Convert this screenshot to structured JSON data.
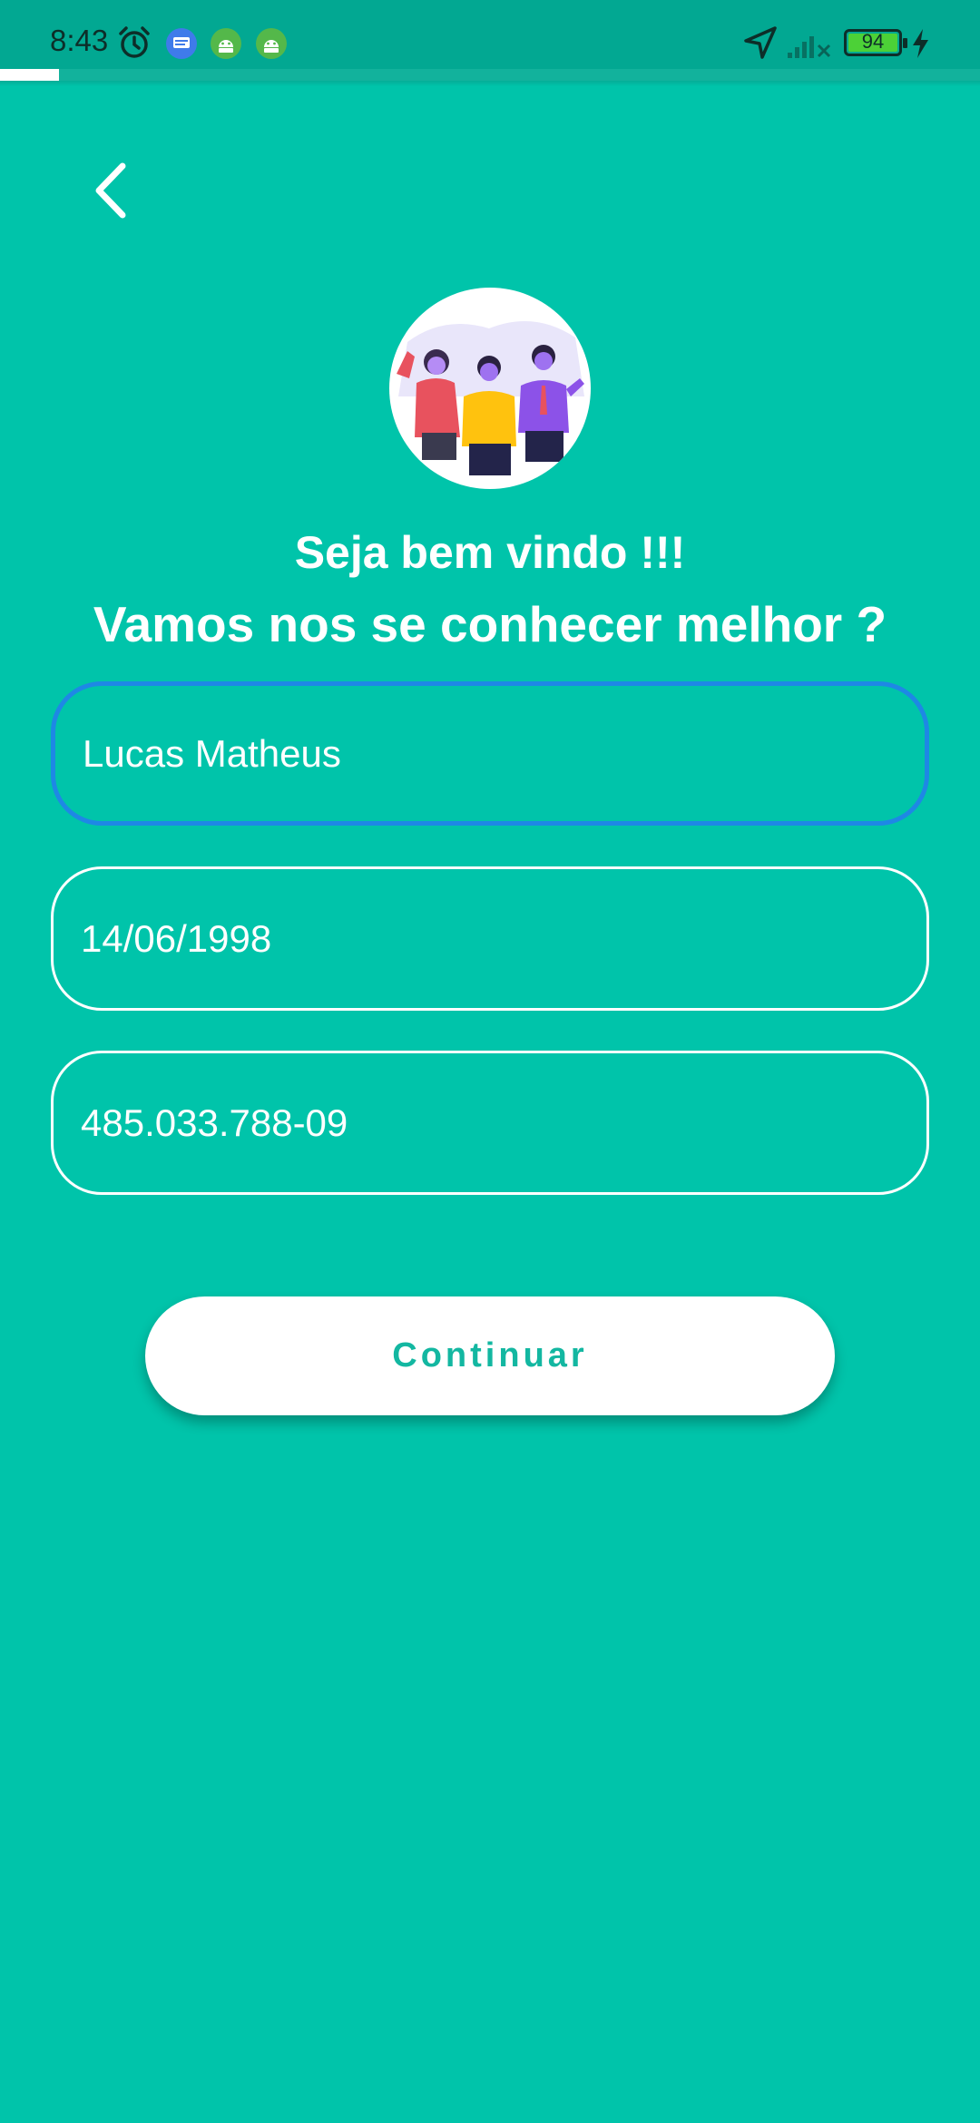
{
  "status_bar": {
    "time": "8:43",
    "battery_level": "94",
    "icons": [
      "alarm-icon",
      "messages-icon",
      "android-icon",
      "android-icon",
      "location-icon",
      "signal-icon",
      "battery-icon",
      "charging-icon"
    ]
  },
  "progress": {
    "value_percent": 6
  },
  "header": {
    "back_icon": "chevron-left-icon"
  },
  "welcome": {
    "title": "Seja bem vindo !!!",
    "subtitle": "Vamos nos se conhecer melhor ?"
  },
  "form": {
    "name_value": "Lucas Matheus",
    "birthdate_value": "14/06/1998",
    "cpf_value": "485.033.788-09"
  },
  "actions": {
    "continue_label": "Continuar"
  },
  "colors": {
    "background": "#00C4AA",
    "status_bar": "#02A892",
    "focus_border": "#1E88E5",
    "button_text": "#13B7A1"
  }
}
